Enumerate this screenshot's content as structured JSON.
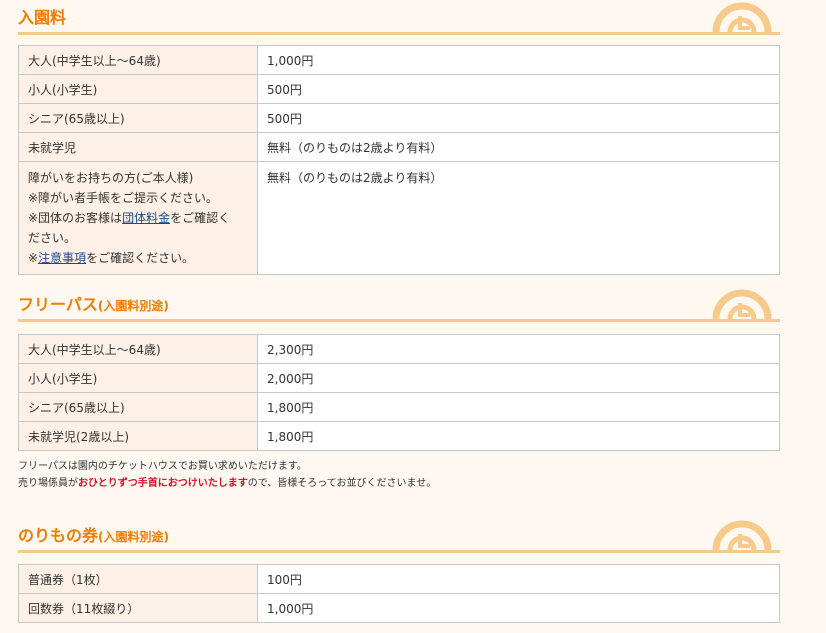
{
  "sections": {
    "admission": {
      "title": "入園料",
      "rows": [
        {
          "label": "大人(中学生以上〜64歳)",
          "value": "1,000円"
        },
        {
          "label": "小人(小学生)",
          "value": "500円"
        },
        {
          "label": "シニア(65歳以上)",
          "value": "500円"
        },
        {
          "label": "未就学児",
          "value": "無料（のりものは2歳より有料）"
        }
      ],
      "disabled_row": {
        "line1": "障がいをお持ちの方(ご本人様)",
        "line2": "※障がい者手帳をご提示ください。",
        "line3_pre": "※団体のお客様は",
        "line3_link": "団体料金",
        "line3_post": "をご確認く",
        "line4": "ださい。",
        "line5_pre": "※",
        "line5_link": "注意事項",
        "line5_post": "をご確認ください。",
        "value": "無料（のりものは2歳より有料）"
      }
    },
    "freepass": {
      "title": "フリーパス",
      "subtitle": "(入園料別途)",
      "rows": [
        {
          "label": "大人(中学生以上〜64歳)",
          "value": "2,300円"
        },
        {
          "label": "小人(小学生)",
          "value": "2,000円"
        },
        {
          "label": "シニア(65歳以上)",
          "value": "1,800円"
        },
        {
          "label": "未就学児(2歳以上)",
          "value": "1,800円"
        }
      ],
      "note1": "フリーパスは園内のチケットハウスでお買い求めいただけます。",
      "note2_pre": "売り場係員が",
      "note2_em": "おひとりずつ手首におつけいたします",
      "note2_post": "ので、皆様そろってお並びくださいませ。"
    },
    "rides": {
      "title": "のりもの券",
      "subtitle": "(入園料別途)",
      "rows": [
        {
          "label": "普通券（1枚）",
          "value": "100円"
        },
        {
          "label": "回数券（11枚綴り）",
          "value": "1,000円"
        }
      ]
    }
  },
  "colors": {
    "accent": "#f07c00",
    "underline": "#f7c98a",
    "label_bg": "#fdf0e6",
    "emphasis": "#d8102a",
    "link": "#1a4a8a"
  },
  "icons": {
    "section_deco": "clock-swirl-icon"
  }
}
